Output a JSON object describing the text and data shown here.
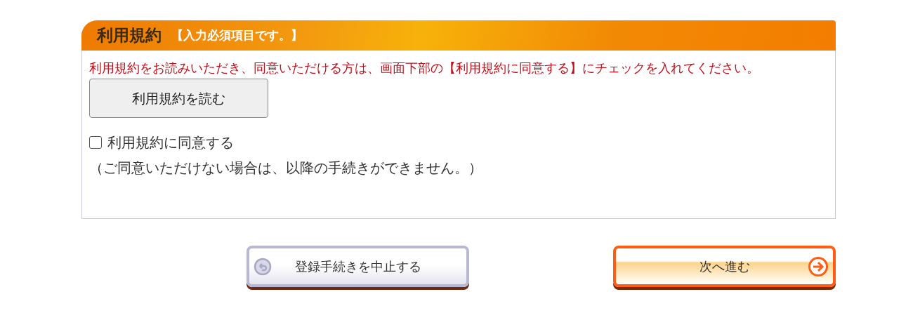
{
  "panel": {
    "title": "利用規約",
    "required_note": "【入力必須項目です。】",
    "instruction": "利用規約をお読みいただき、同意いただける方は、画面下部の【利用規約に同意する】にチェックを入れてください。",
    "read_button": "利用規約を読む",
    "agree": {
      "label": "利用規約に同意する",
      "checked": false
    },
    "note": "（ご同意いただけない場合は、以降の手続きができません。）"
  },
  "buttons": [
    {
      "kind": "cancel",
      "label": "登録手続きを中止する"
    },
    {
      "kind": "next",
      "label": "次へ進む"
    }
  ]
}
